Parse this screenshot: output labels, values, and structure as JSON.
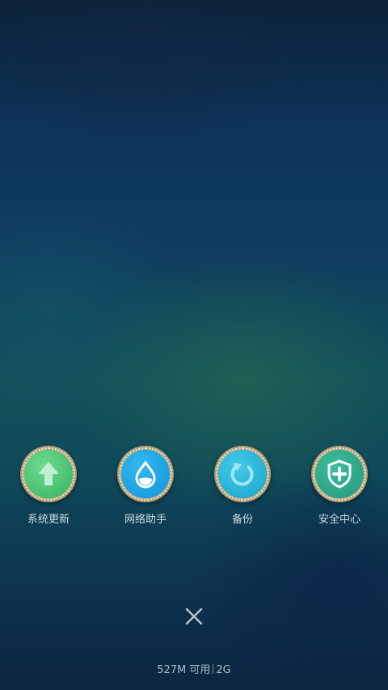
{
  "launchers": [
    {
      "label": "系统更新",
      "icon": "arrow-up-icon",
      "color": "#4fc67a"
    },
    {
      "label": "网络助手",
      "icon": "water-drop-icon",
      "color": "#1ea6e6"
    },
    {
      "label": "备份",
      "icon": "refresh-icon",
      "color": "#28b3d6"
    },
    {
      "label": "安全中心",
      "icon": "shield-plus-icon",
      "color": "#2ca58a"
    }
  ],
  "close": {
    "icon": "close-icon"
  },
  "status": {
    "memory": "527M",
    "available": "可用",
    "total": "2G"
  }
}
